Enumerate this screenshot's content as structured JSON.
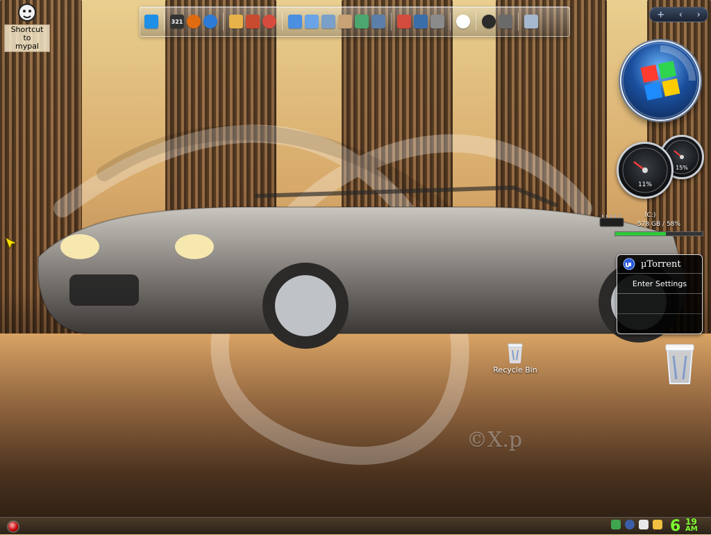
{
  "desktop": {
    "shortcuts": [
      {
        "label": "Shortcut to\nmypal"
      },
      {
        "label": "Recycle Bin"
      }
    ],
    "watermark": "©X.p"
  },
  "dock": {
    "icons": [
      "media-player-icon",
      "clock-321-icon",
      "firefox-icon",
      "network-globe-icon",
      "paint-icon",
      "books-icon",
      "refresh-icon",
      "people-icon",
      "document-icon",
      "calculator-icon",
      "user-icon",
      "photos-icon",
      "app-grid-icon",
      "pencil-icon",
      "window-icon",
      "monitor-icon",
      "windows-logo-icon",
      "power-icon",
      "sound-icon",
      "trash-icon"
    ]
  },
  "widgets": {
    "cpu_percent": "11%",
    "ram_percent": "15%",
    "drive": {
      "name": "(C:)",
      "usage": "578 GB / 58%",
      "percent": 58
    },
    "utorrent": {
      "title": "µTorrent",
      "settings_label": "Enter Settings"
    }
  },
  "sidebar_tabs": {
    "add": "+",
    "prev": "‹",
    "next": "›"
  },
  "taskbar": {
    "time": {
      "hour": "6",
      "minute": "19",
      "ampm": "AM"
    }
  },
  "colors": {
    "clock": "#7bff2f",
    "drive_fill": "#31c83b"
  }
}
